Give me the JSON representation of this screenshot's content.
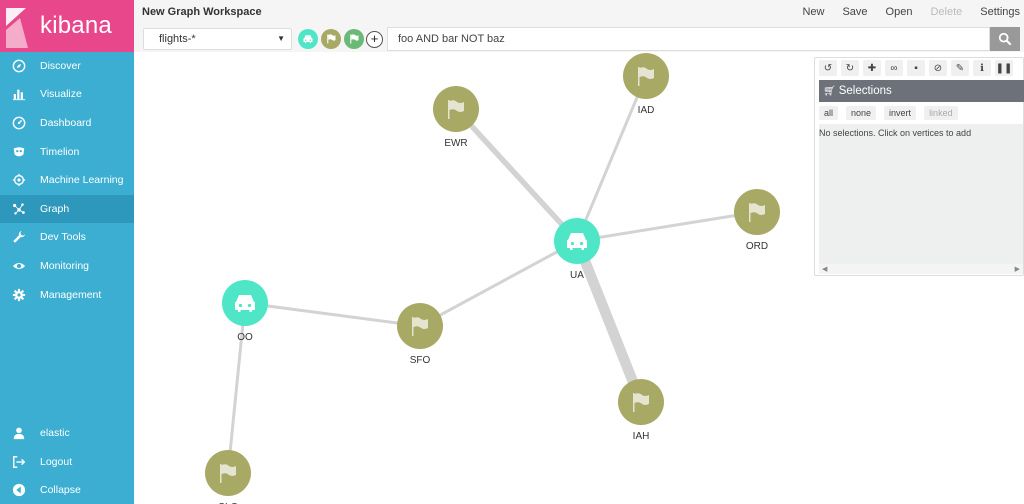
{
  "brand": {
    "name": "kibana",
    "color": "#e8488b",
    "sidebar_color": "#3caed2"
  },
  "nav": {
    "items": [
      {
        "label": "Discover",
        "icon": "compass-icon"
      },
      {
        "label": "Visualize",
        "icon": "bar-chart-icon"
      },
      {
        "label": "Dashboard",
        "icon": "gauge-icon"
      },
      {
        "label": "Timelion",
        "icon": "mask-icon"
      },
      {
        "label": "Machine Learning",
        "icon": "brain-icon"
      },
      {
        "label": "Graph",
        "icon": "graph-icon"
      },
      {
        "label": "Dev Tools",
        "icon": "wrench-icon"
      },
      {
        "label": "Monitoring",
        "icon": "eye-icon"
      },
      {
        "label": "Management",
        "icon": "gear-icon"
      }
    ],
    "active": "Graph",
    "bottom": [
      {
        "label": "elastic",
        "icon": "user-icon"
      },
      {
        "label": "Logout",
        "icon": "logout-icon"
      },
      {
        "label": "Collapse",
        "icon": "collapse-icon"
      }
    ]
  },
  "workspace": {
    "title": "New Graph Workspace"
  },
  "top_menu": {
    "new": "New",
    "save": "Save",
    "open": "Open",
    "delete": "Delete",
    "settings": "Settings"
  },
  "toolbar": {
    "index": "flights-*",
    "fields": [
      {
        "icon": "car-icon",
        "color": "#4ee6c6"
      },
      {
        "icon": "flag-icon",
        "color": "#a8a965"
      },
      {
        "icon": "flag-icon",
        "color": "#6ab977"
      }
    ],
    "add_label": "+",
    "search_value": "foo AND bar NOT baz",
    "search_icon": "magnifier-icon"
  },
  "graph": {
    "colors": {
      "carrier": "#4ee6c6",
      "airport": "#a8a965",
      "edge": "#d3d3d3"
    },
    "nodes": [
      {
        "id": "UA",
        "type": "carrier"
      },
      {
        "id": "OO",
        "type": "carrier"
      },
      {
        "id": "EWR",
        "type": "airport"
      },
      {
        "id": "IAD",
        "type": "airport"
      },
      {
        "id": "ORD",
        "type": "airport"
      },
      {
        "id": "SFO",
        "type": "airport"
      },
      {
        "id": "IAH",
        "type": "airport"
      },
      {
        "id": "SLC",
        "type": "airport"
      }
    ],
    "edges": [
      {
        "from": "UA",
        "to": "EWR",
        "weight": 2
      },
      {
        "from": "UA",
        "to": "IAD",
        "weight": 1
      },
      {
        "from": "UA",
        "to": "ORD",
        "weight": 1
      },
      {
        "from": "UA",
        "to": "SFO",
        "weight": 1
      },
      {
        "from": "UA",
        "to": "IAH",
        "weight": 4
      },
      {
        "from": "OO",
        "to": "SFO",
        "weight": 1
      },
      {
        "from": "OO",
        "to": "SLC",
        "weight": 1
      }
    ]
  },
  "selections": {
    "title": "Selections",
    "filters": [
      "all",
      "none",
      "invert",
      "linked"
    ],
    "empty_text": "No selections. Click on vertices to add",
    "tools": [
      "undo-icon",
      "redo-icon",
      "expand-icon",
      "link-icon",
      "trash-icon",
      "block-icon",
      "brush-icon",
      "info-icon",
      "pause-icon"
    ]
  }
}
